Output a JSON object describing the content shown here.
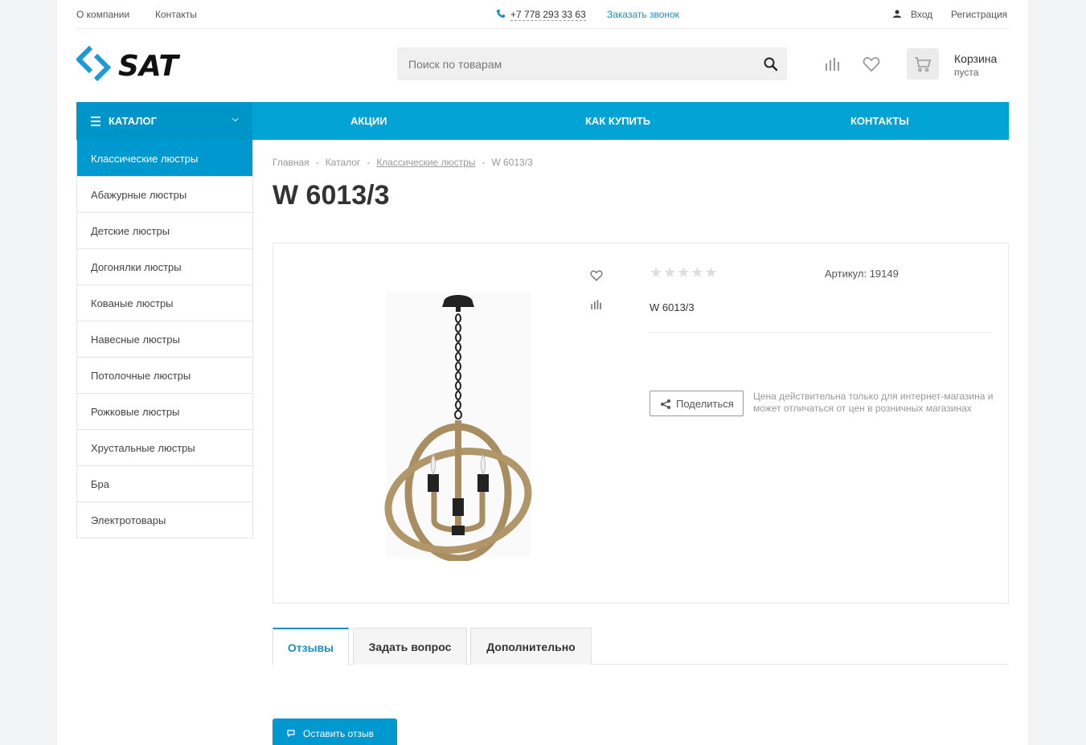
{
  "topbar": {
    "about": "О компании",
    "contacts": "Контакты",
    "phone": "+7 778 293 33 63",
    "callback": "Заказать звонок",
    "login": "Вход",
    "register": "Регистрация"
  },
  "header": {
    "logo_text": "SAT",
    "search_placeholder": "Поиск по товарам",
    "cart_title": "Корзина",
    "cart_status": "пуста"
  },
  "nav": {
    "catalog": "КАТАЛОГ",
    "items": [
      "АКЦИИ",
      "КАК КУПИТЬ",
      "КОНТАКТЫ"
    ]
  },
  "sidebar": {
    "items": [
      "Классические люстры",
      "Абажурные люстры",
      "Детские люстры",
      "Догонялки люстры",
      "Кованые люстры",
      "Навесные люстры",
      "Потолочные люстры",
      "Рожковые люстры",
      "Хрустальные люстры",
      "Бра",
      "Электротовары"
    ]
  },
  "breadcrumbs": [
    "Главная",
    "Каталог",
    "Классические люстры",
    "W 6013/3"
  ],
  "product": {
    "title": "W 6013/3",
    "sku": "Артикул: 19149",
    "name": "W 6013/3",
    "rating": 0,
    "stars": "★★★★★",
    "share": "Поделиться",
    "price_note": "Цена действительна только для интернет-магазина и может отличаться от цен в розничных магазинах"
  },
  "tabs": [
    "Отзывы",
    "Задать вопрос",
    "Дополнительно"
  ],
  "review_button": "Оставить отзыв",
  "colors": {
    "accent": "#00a3d4",
    "accent_dark": "#0095c8",
    "link": "#1a8ec4"
  }
}
